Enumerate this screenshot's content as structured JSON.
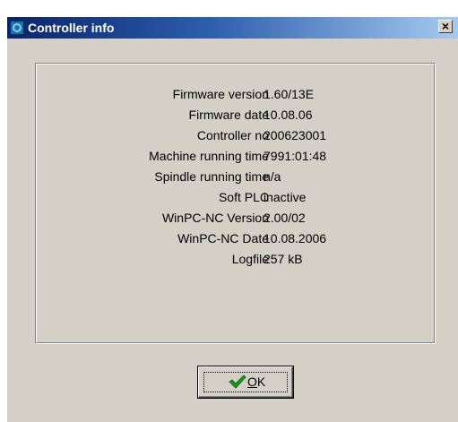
{
  "window": {
    "title": "Controller info",
    "close_label": "×"
  },
  "info": {
    "rows": [
      {
        "label": "Firmware version",
        "value": "1.60/13E"
      },
      {
        "label": "Firmware date",
        "value": "10.08.06"
      },
      {
        "label": "Controller no",
        "value": "200623001"
      },
      {
        "label": "Machine running time",
        "value": "7991:01:48"
      },
      {
        "label": "Spindle running time",
        "value": "n/a"
      },
      {
        "label": "Soft PLC",
        "value": "inactive"
      },
      {
        "label": "WinPC-NC Version",
        "value": "2.00/02"
      },
      {
        "label": "WinPC-NC Date",
        "value": "10.08.2006"
      },
      {
        "label": "Logfile",
        "value": "257 kB"
      }
    ]
  },
  "ok_button": {
    "label_mnemonic": "O",
    "label_rest": "K",
    "icon": "checkmark-icon",
    "icon_color": "#1a9a1a"
  },
  "colors": {
    "titlebar_start": "#0a246a",
    "titlebar_end": "#a6caf0",
    "dialog_bg": "#d4d0c8"
  }
}
